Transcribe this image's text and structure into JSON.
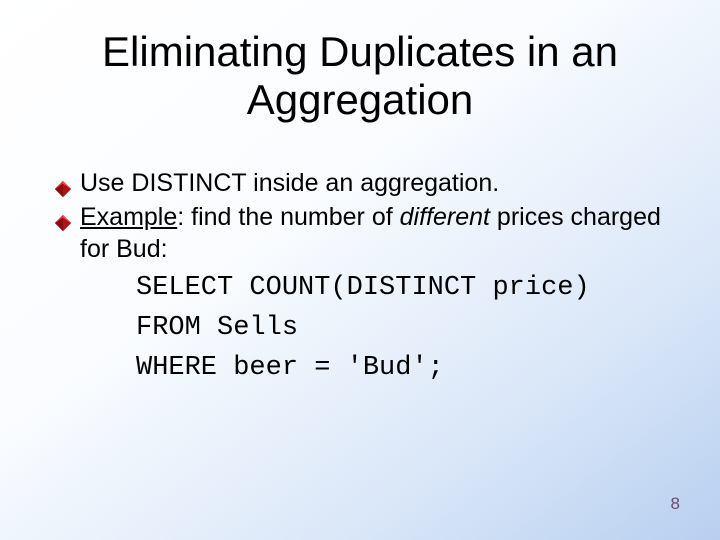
{
  "title": "Eliminating Duplicates in an Aggregation",
  "bullets": {
    "b1": "Use DISTINCT inside an aggregation.",
    "b2_label": "Example",
    "b2_before_italic": ": find the number of ",
    "b2_italic": "different",
    "b2_after_italic": " prices charged for Bud:"
  },
  "code": {
    "line1": "SELECT COUNT(DISTINCT price)",
    "line2": "FROM Sells",
    "line3": "WHERE beer = 'Bud';"
  },
  "page_number": "8",
  "icons": {
    "diamond": "diamond-bullet-icon"
  },
  "colors": {
    "bullet_fill": "#d01818",
    "bullet_shadow": "#5a0808"
  }
}
